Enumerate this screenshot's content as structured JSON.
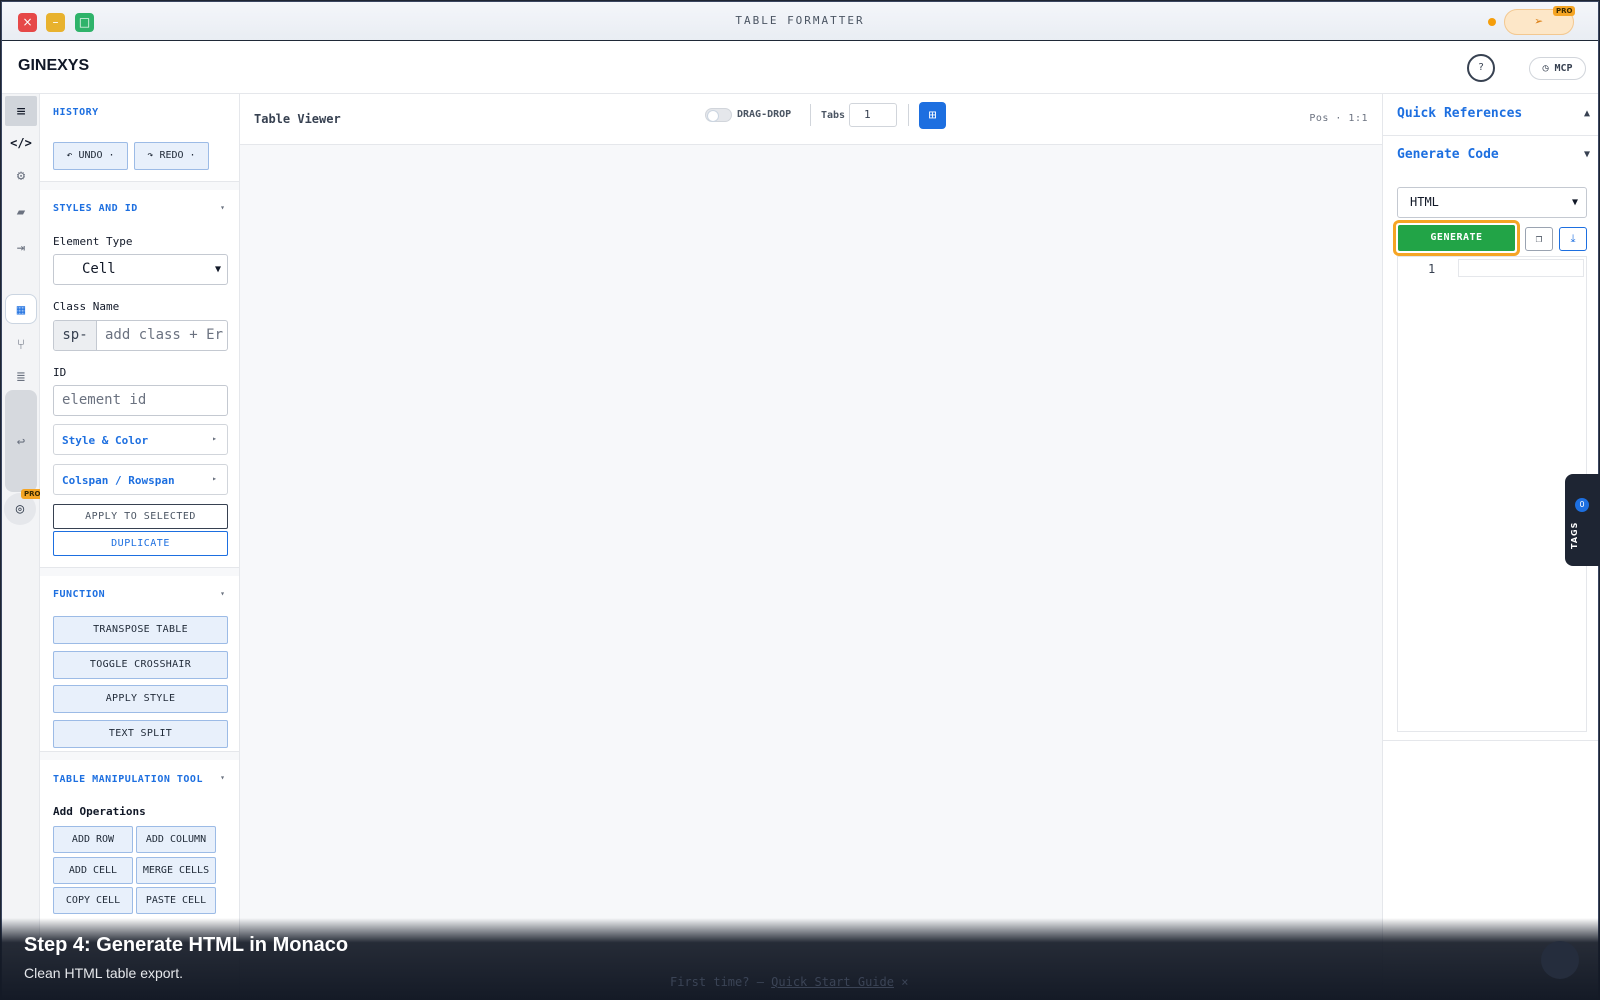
{
  "window": {
    "title": "TABLE FORMATTER",
    "pro_label": "PRO"
  },
  "header": {
    "logo": "GINEXYS",
    "help_label": "?",
    "mcp_label": "MCP"
  },
  "rail": {
    "menu_glyph": "≡",
    "code_glyph": "</>",
    "pro_label": "PRO"
  },
  "history": {
    "title": "HISTORY",
    "undo_label": "↶ UNDO ·",
    "redo_label": "↷ REDO ·"
  },
  "styles": {
    "title": "STYLES AND ID",
    "element_type_label": "Element Type",
    "element_type_value": "Cell",
    "class_name_label": "Class Name",
    "class_prefix": "sp-",
    "class_placeholder": "add class + Er",
    "id_label": "ID",
    "id_placeholder": "element id",
    "style_color_label": "Style & Color",
    "colspan_label": "Colspan / Rowspan",
    "apply_label": "APPLY TO SELECTED",
    "duplicate_label": "DUPLICATE"
  },
  "function": {
    "title": "FUNCTION",
    "buttons": [
      "TRANSPOSE TABLE",
      "TOGGLE CROSSHAIR",
      "APPLY STYLE",
      "TEXT SPLIT"
    ]
  },
  "table_tool": {
    "title": "TABLE MANIPULATION TOOL",
    "add_ops_label": "Add Operations",
    "ops": [
      "ADD ROW",
      "ADD COLUMN",
      "ADD CELL",
      "MERGE CELLS",
      "COPY CELL",
      "PASTE CELL"
    ]
  },
  "viewer": {
    "title": "Table Viewer",
    "drag_drop_label": "DRAG-DROP",
    "drag_drop_on": false,
    "tabs_label": "Tabs",
    "tabs_value": "1",
    "pos_label": "Pos · 1:1"
  },
  "right": {
    "quick_refs_label": "Quick References",
    "quick_refs_arrow": "▲",
    "generate_code_label": "Generate Code",
    "generate_code_arrow": "▼",
    "language_value": "HTML",
    "generate_label": "GENERATE",
    "line_number": "1"
  },
  "tags": {
    "count": "0",
    "label": "TAGS"
  },
  "overlay": {
    "title": "Step 4: Generate HTML in Monaco",
    "subtitle": "Clean HTML table export.",
    "hint_prefix": "First time? — ",
    "hint_link": "Quick Start Guide",
    "hint_close": "×"
  },
  "colors": {
    "accent": "#1d6fe0",
    "generate": "#22a447",
    "highlight": "#f5a524"
  }
}
